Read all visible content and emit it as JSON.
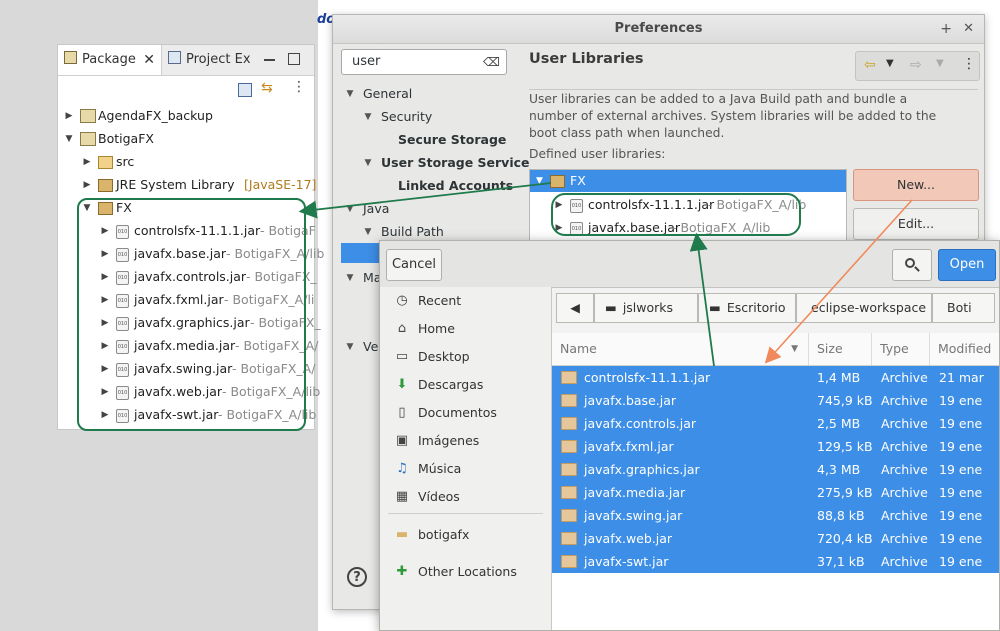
{
  "background": {
    "fragment": "do"
  },
  "package_explorer": {
    "tabs": [
      {
        "label": "Package"
      },
      {
        "label": "Project Ex"
      }
    ],
    "tree": [
      {
        "label": "AgendaFX_backup"
      },
      {
        "label": "BotigaFX"
      },
      {
        "label": "src"
      },
      {
        "label": "JRE System Library",
        "suffix": "[JavaSE-17]"
      },
      {
        "label": "FX"
      }
    ],
    "jars": [
      {
        "name": "controlsfx-11.1.1.jar",
        "path": " - BotigaF"
      },
      {
        "name": "javafx.base.jar",
        "path": " - BotigaFX_A/lib"
      },
      {
        "name": "javafx.controls.jar",
        "path": " - BotigaFX_"
      },
      {
        "name": "javafx.fxml.jar",
        "path": " - BotigaFX_A/li"
      },
      {
        "name": "javafx.graphics.jar",
        "path": " - BotigaFX_"
      },
      {
        "name": "javafx.media.jar",
        "path": " - BotigaFX_A/"
      },
      {
        "name": "javafx.swing.jar",
        "path": " - BotigaFX_A/"
      },
      {
        "name": "javafx.web.jar",
        "path": " - BotigaFX_A/lib"
      },
      {
        "name": "javafx-swt.jar",
        "path": " - BotigaFX_A/lib"
      }
    ]
  },
  "preferences": {
    "title": "Preferences",
    "search_value": "user",
    "tree": [
      {
        "label": "General"
      },
      {
        "label": "Security"
      },
      {
        "label": "Secure Storage"
      },
      {
        "label": "User Storage Service"
      },
      {
        "label": "Linked Accounts"
      },
      {
        "label": "Java"
      },
      {
        "label": "Build Path"
      },
      {
        "label": "Ma"
      },
      {
        "label": "Ver"
      }
    ],
    "page_title": "User Libraries",
    "description": "User libraries can be added to a Java Build path and bundle a number of external archives. System libraries will be added to the boot class path when launched.",
    "defined_label": "Defined user libraries:",
    "library": {
      "name": "FX"
    },
    "entries": [
      {
        "name": "controlsfx-11.1.1.jar",
        "path": " - BotigaFX_A/lib"
      },
      {
        "name": "javafx.base.jar",
        "path": " - BotigaFX_A/lib"
      }
    ],
    "buttons": {
      "new": "New...",
      "edit": "Edit..."
    }
  },
  "file_chooser": {
    "cancel": "Cancel",
    "open": "Open",
    "places": [
      {
        "label": "Recent",
        "icon": "clock-icon"
      },
      {
        "label": "Home",
        "icon": "home-icon"
      },
      {
        "label": "Desktop",
        "icon": "desktop-icon"
      },
      {
        "label": "Descargas",
        "icon": "download-icon"
      },
      {
        "label": "Documentos",
        "icon": "document-icon"
      },
      {
        "label": "Imágenes",
        "icon": "image-icon"
      },
      {
        "label": "Música",
        "icon": "music-icon"
      },
      {
        "label": "Vídeos",
        "icon": "video-icon"
      },
      {
        "label": "botigafx",
        "icon": "folder-icon"
      },
      {
        "label": "Other Locations",
        "icon": "plus-icon"
      }
    ],
    "breadcrumb": [
      "jslworks",
      "Escritorio",
      "eclipse-workspace",
      "Boti"
    ],
    "columns": {
      "name": "Name",
      "size": "Size",
      "type": "Type",
      "modified": "Modified"
    },
    "files": [
      {
        "name": "controlsfx-11.1.1.jar",
        "size": "1,4 MB",
        "type": "Archive",
        "modified": "21 mar"
      },
      {
        "name": "javafx.base.jar",
        "size": "745,9 kB",
        "type": "Archive",
        "modified": "19 ene"
      },
      {
        "name": "javafx.controls.jar",
        "size": "2,5 MB",
        "type": "Archive",
        "modified": "19 ene"
      },
      {
        "name": "javafx.fxml.jar",
        "size": "129,5 kB",
        "type": "Archive",
        "modified": "19 ene"
      },
      {
        "name": "javafx.graphics.jar",
        "size": "4,3 MB",
        "type": "Archive",
        "modified": "19 ene"
      },
      {
        "name": "javafx.media.jar",
        "size": "275,9 kB",
        "type": "Archive",
        "modified": "19 ene"
      },
      {
        "name": "javafx.swing.jar",
        "size": "88,8 kB",
        "type": "Archive",
        "modified": "19 ene"
      },
      {
        "name": "javafx.web.jar",
        "size": "720,4 kB",
        "type": "Archive",
        "modified": "19 ene"
      },
      {
        "name": "javafx-swt.jar",
        "size": "37,1 kB",
        "type": "Archive",
        "modified": "19 ene"
      }
    ]
  },
  "colors": {
    "selection": "#3d8ee6",
    "annotation": "#1f7a4c",
    "arrow_orange": "#f08a5d"
  }
}
